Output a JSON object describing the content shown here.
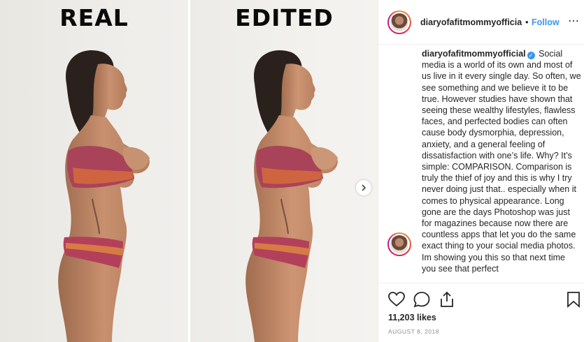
{
  "media": {
    "left_label": "REAL",
    "right_label": "EDITED",
    "next_icon": "chevron-right-icon"
  },
  "header": {
    "username": "diaryofafitmommyofficia",
    "separator": "•",
    "follow_label": "Follow",
    "more_icon": "ellipsis-icon"
  },
  "caption": {
    "username": "diaryofafitmommyofficial",
    "verified_icon": "verified-badge-icon",
    "text": "Social media is a world of its own and most of us live in it every single day. So often, we see something and we believe it to be true. However studies have shown that seeing these wealthy lifestyles, flawless faces, and perfected bodies can often cause body dysmorphia, depression, anxiety, and a general feeling of dissatisfaction with one’s life. Why? It’s simple: COMPARISON. Comparison is truly the thief of joy and this is why I try never doing just that.. especially when it comes to physical appearance. Long gone are the days Photoshop was just for magazines because now there are countless apps that let you do the same exact thing to your social media photos. Im showing you this so that next time you see that perfect"
  },
  "actions": {
    "like_icon": "heart-icon",
    "comment_icon": "comment-icon",
    "share_icon": "share-icon",
    "save_icon": "bookmark-icon",
    "likes": "11,203 likes",
    "date": "AUGUST 8, 2018"
  },
  "colors": {
    "accent": "#3897f0",
    "text": "#262626",
    "muted": "#8e8e8e",
    "divider": "#efefef"
  }
}
